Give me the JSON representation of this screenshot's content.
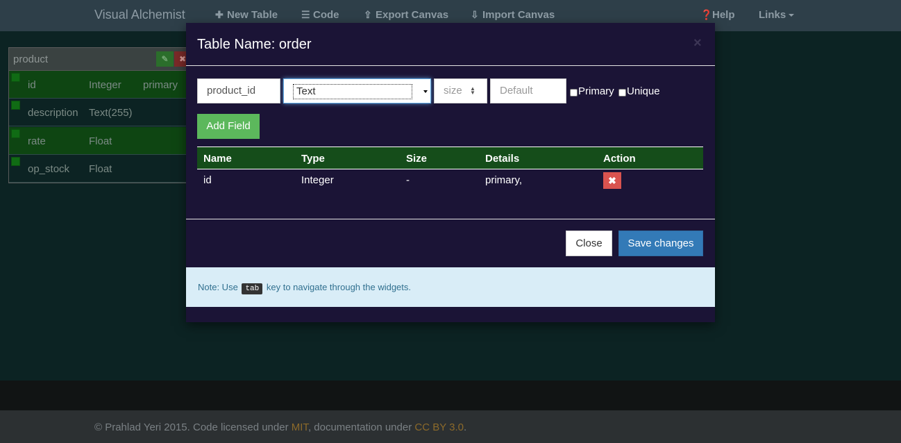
{
  "navbar": {
    "brand": "Visual Alchemist",
    "items": [
      {
        "label": "New Table",
        "icon": "plus-icon"
      },
      {
        "label": "Code",
        "icon": "list-icon"
      },
      {
        "label": "Export Canvas",
        "icon": "export-icon"
      },
      {
        "label": "Import Canvas",
        "icon": "import-icon"
      }
    ],
    "help": {
      "label": "Help",
      "icon": "question-circle-icon"
    },
    "links": {
      "label": "Links",
      "icon": "caret-down-icon"
    }
  },
  "canvas_table": {
    "title": "product",
    "edit_icon": "edit-icon",
    "delete_icon": "close-icon",
    "rows": [
      {
        "name": "id",
        "type": "Integer",
        "extra": "primary"
      },
      {
        "name": "description",
        "type": "Text(255)",
        "extra": ""
      },
      {
        "name": "rate",
        "type": "Float",
        "extra": ""
      },
      {
        "name": "op_stock",
        "type": "Float",
        "extra": ""
      }
    ]
  },
  "modal": {
    "title": "Table Name: order",
    "close_icon": "close-icon",
    "form": {
      "field_name_value": "product_id",
      "type_selected": "Text",
      "size_placeholder": "size",
      "default_placeholder": "Default",
      "primary_label": "Primary",
      "unique_label": "Unique",
      "add_button": "Add Field"
    },
    "fields_table": {
      "headers": [
        "Name",
        "Type",
        "Size",
        "Details",
        "Action"
      ],
      "rows": [
        {
          "name": "id",
          "type": "Integer",
          "size": "-",
          "details": "primary,"
        }
      ],
      "remove_icon": "remove-icon"
    },
    "footer": {
      "close_button": "Close",
      "save_button": "Save changes"
    },
    "note": {
      "prefix": "Note: Use",
      "key": "tab",
      "suffix": "key to navigate through the widgets."
    }
  },
  "footer": {
    "text_1": "© Prahlad Yeri 2015. Code licensed under",
    "link_1": "MIT",
    "text_2": ", documentation under",
    "link_2": "CC BY 3.0",
    "text_3": "."
  },
  "colors": {
    "navbar_bg": "#2e3f49",
    "canvas_bg": "#0c2323",
    "modal_bg": "#1b1436",
    "table_header_bg": "#154d1a",
    "add_button": "#5cb85c",
    "save_button": "#337ab7",
    "remove_button": "#d9534f",
    "note_bg": "#d9edf7"
  }
}
